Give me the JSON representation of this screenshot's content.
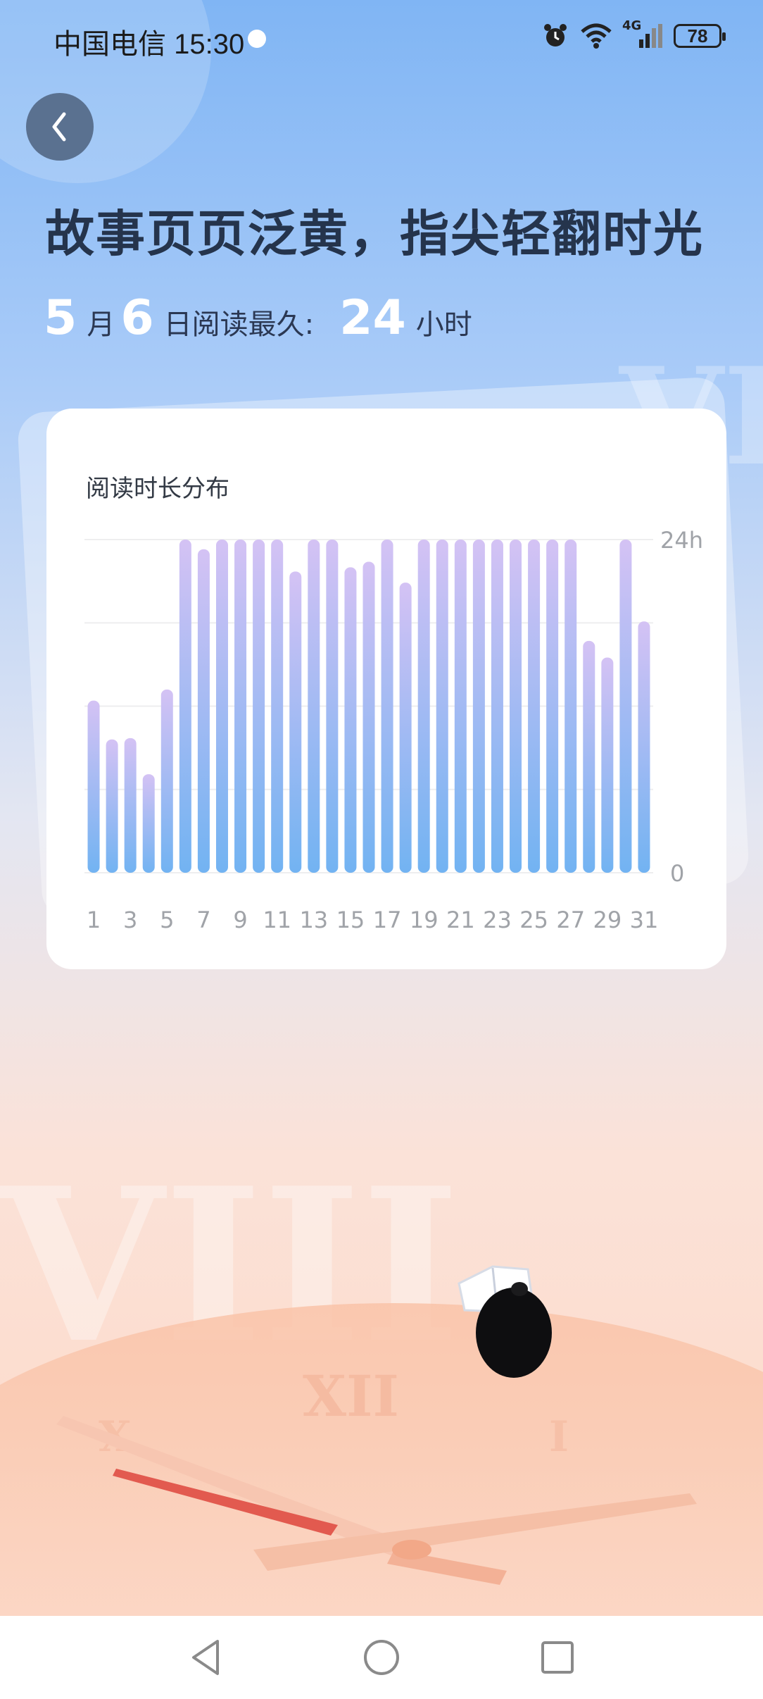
{
  "status_bar": {
    "carrier_time": "中国电信 15:30",
    "battery": "78",
    "network": "4G"
  },
  "header": {
    "headline": "故事页页泛黄，指尖轻翻时光"
  },
  "summary": {
    "month": "5",
    "month_unit": "月",
    "day": "6",
    "day_suffix": "日阅读最久:",
    "hours": "24",
    "hours_unit": "小时"
  },
  "card": {
    "title": "阅读时长分布"
  },
  "chart_data": {
    "type": "bar",
    "title": "阅读时长分布",
    "xlabel": "",
    "ylabel": "",
    "ylim": [
      0,
      24
    ],
    "y_tick_labels": [
      "24h",
      "0"
    ],
    "x_tick_labels": [
      "1",
      "3",
      "5",
      "7",
      "9",
      "11",
      "13",
      "15",
      "17",
      "19",
      "21",
      "23",
      "25",
      "27",
      "29",
      "31"
    ],
    "categories": [
      "1",
      "2",
      "3",
      "4",
      "5",
      "6",
      "7",
      "8",
      "9",
      "10",
      "11",
      "12",
      "13",
      "14",
      "15",
      "16",
      "17",
      "18",
      "19",
      "20",
      "21",
      "22",
      "23",
      "24",
      "25",
      "26",
      "27",
      "28",
      "29",
      "30",
      "31"
    ],
    "values": [
      12.4,
      9.6,
      9.7,
      7.1,
      13.2,
      24,
      23.3,
      24,
      24,
      24,
      24,
      21.7,
      24,
      24,
      22,
      22.4,
      24,
      20.9,
      24,
      24,
      24,
      24,
      24,
      24,
      24,
      24,
      24,
      16.7,
      15.5,
      24,
      18.1
    ],
    "grid": true,
    "bar_color_top": "#d4c2f4",
    "bar_color_bottom": "#72b3f2"
  },
  "nav": {
    "back": "back-triangle-icon",
    "home": "home-circle-icon",
    "recents": "recents-square-icon"
  },
  "colors": {
    "headline": "#25344c",
    "back_button": "#5a7190"
  }
}
